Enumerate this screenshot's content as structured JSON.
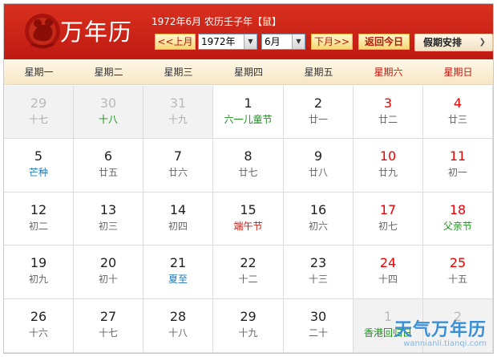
{
  "header": {
    "title": "万年历",
    "info": "1972年6月 农历壬子年【",
    "zodiac": "鼠",
    "info_end": "】",
    "prev_month": "<<上月",
    "year_value": "1972年",
    "month_value": "6月",
    "next_month": "下月>>",
    "today": "返回今日",
    "holiday_menu": "假期安排"
  },
  "weekdays": [
    "星期一",
    "星期二",
    "星期三",
    "星期四",
    "星期五",
    "星期六",
    "星期日"
  ],
  "days": [
    {
      "d": "29",
      "s": "十七",
      "other": true
    },
    {
      "d": "30",
      "s": "十八",
      "other": true,
      "type": "fest"
    },
    {
      "d": "31",
      "s": "十九",
      "other": true
    },
    {
      "d": "1",
      "s": "六一儿童节",
      "type": "fest"
    },
    {
      "d": "2",
      "s": "廿一"
    },
    {
      "d": "3",
      "s": "廿二",
      "weekend": true
    },
    {
      "d": "4",
      "s": "廿三",
      "weekend": true
    },
    {
      "d": "5",
      "s": "芒种",
      "type": "term"
    },
    {
      "d": "6",
      "s": "廿五"
    },
    {
      "d": "7",
      "s": "廿六"
    },
    {
      "d": "8",
      "s": "廿七"
    },
    {
      "d": "9",
      "s": "廿八"
    },
    {
      "d": "10",
      "s": "廿九",
      "weekend": true
    },
    {
      "d": "11",
      "s": "初一",
      "weekend": true
    },
    {
      "d": "12",
      "s": "初二"
    },
    {
      "d": "13",
      "s": "初三"
    },
    {
      "d": "14",
      "s": "初四"
    },
    {
      "d": "15",
      "s": "端午节",
      "type": "festred"
    },
    {
      "d": "16",
      "s": "初六"
    },
    {
      "d": "17",
      "s": "初七",
      "weekend": true
    },
    {
      "d": "18",
      "s": "父亲节",
      "weekend": true,
      "type": "fest"
    },
    {
      "d": "19",
      "s": "初九"
    },
    {
      "d": "20",
      "s": "初十"
    },
    {
      "d": "21",
      "s": "夏至",
      "type": "term"
    },
    {
      "d": "22",
      "s": "十二"
    },
    {
      "d": "23",
      "s": "十三"
    },
    {
      "d": "24",
      "s": "十四",
      "weekend": true
    },
    {
      "d": "25",
      "s": "十五",
      "weekend": true
    },
    {
      "d": "26",
      "s": "十六"
    },
    {
      "d": "27",
      "s": "十七"
    },
    {
      "d": "28",
      "s": "十八"
    },
    {
      "d": "29",
      "s": "十九"
    },
    {
      "d": "30",
      "s": "二十"
    },
    {
      "d": "1",
      "s": "香港回归日",
      "other": true,
      "type": "fest"
    },
    {
      "d": "2",
      "s": "",
      "other": true
    }
  ],
  "watermark": {
    "title": "天气万年历",
    "url": "wannianli.tianqi.com"
  },
  "colors": {
    "header_red": "#c41a10",
    "weekend_red": "#e00000",
    "festival_green": "#1a8f1a",
    "solar_term_blue": "#1f79b5"
  }
}
